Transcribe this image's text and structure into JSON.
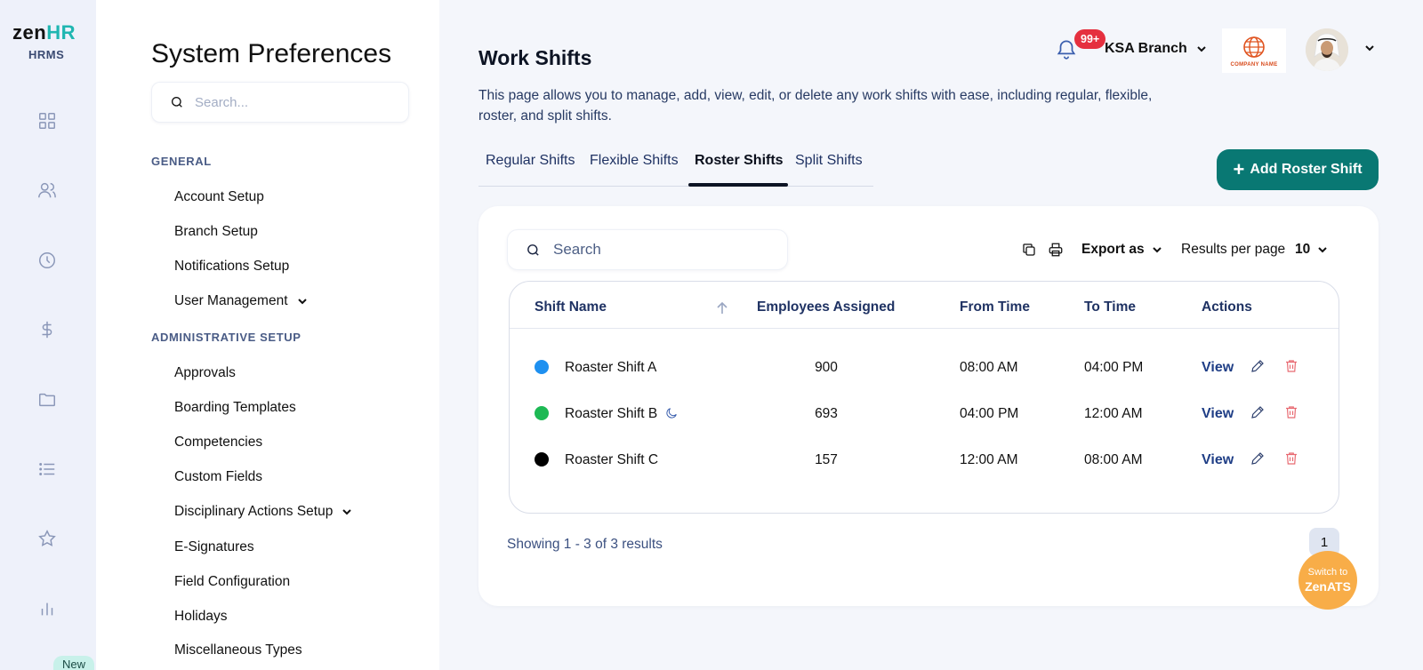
{
  "brand": {
    "logo_main": "zen",
    "logo_accent": "HR",
    "subtitle": "HRMS",
    "accent_color": "#1fb6b1"
  },
  "rail": {
    "icons": [
      "dashboard-icon",
      "people-icon",
      "clock-icon",
      "dollar-icon",
      "folder-icon",
      "list-icon",
      "star-icon",
      "chart-icon"
    ],
    "new_badge": "New"
  },
  "settings": {
    "title": "System Preferences",
    "search_placeholder": "Search...",
    "general_heading": "GENERAL",
    "general_items": [
      "Account Setup",
      "Branch Setup",
      "Notifications Setup",
      "User Management"
    ],
    "admin_heading": "ADMINISTRATIVE SETUP",
    "admin_items": [
      "Approvals",
      "Boarding Templates",
      "Competencies",
      "Custom Fields",
      "Disciplinary Actions Setup",
      "E-Signatures",
      "Field Configuration",
      "Holidays",
      "Miscellaneous Types"
    ]
  },
  "header": {
    "notifications_count": "99+",
    "branch": "KSA Branch",
    "company_logo_text": "COMPANY NAME"
  },
  "page": {
    "title": "Work Shifts",
    "description": "This page allows you to manage, add, view, edit, or delete any work shifts with ease, including regular, flexible, roster, and split shifts."
  },
  "tabs": [
    {
      "label": "Regular Shifts",
      "active": false
    },
    {
      "label": "Flexible Shifts",
      "active": false
    },
    {
      "label": "Roster Shifts",
      "active": true
    },
    {
      "label": "Split Shifts",
      "active": false
    }
  ],
  "add_button": "Add Roster Shift",
  "toolbar": {
    "search_placeholder": "Search",
    "export_label": "Export as",
    "results_label": "Results per page",
    "results_value": "10"
  },
  "table": {
    "columns": [
      "Shift Name",
      "Employees Assigned",
      "From Time",
      "To Time",
      "Actions"
    ],
    "rows": [
      {
        "name": "Roaster Shift A",
        "color": "#1e90f0",
        "employees": "900",
        "from": "08:00 AM",
        "to": "04:00 PM",
        "night": false,
        "action": "View"
      },
      {
        "name": "Roaster Shift B",
        "color": "#1db954",
        "employees": "693",
        "from": "04:00 PM",
        "to": "12:00 AM",
        "night": true,
        "action": "View"
      },
      {
        "name": "Roaster Shift C",
        "color": "#000000",
        "employees": "157",
        "from": "12:00 AM",
        "to": "08:00 AM",
        "night": false,
        "action": "View"
      }
    ]
  },
  "pagination": {
    "summary": "Showing 1 - 3 of 3 results",
    "current_page": "1"
  },
  "switch_button": {
    "line1": "Switch to",
    "line2": "ZenATS"
  },
  "colors": {
    "primary": "#097873",
    "danger": "#e5303f",
    "switch": "#f8ad48"
  }
}
